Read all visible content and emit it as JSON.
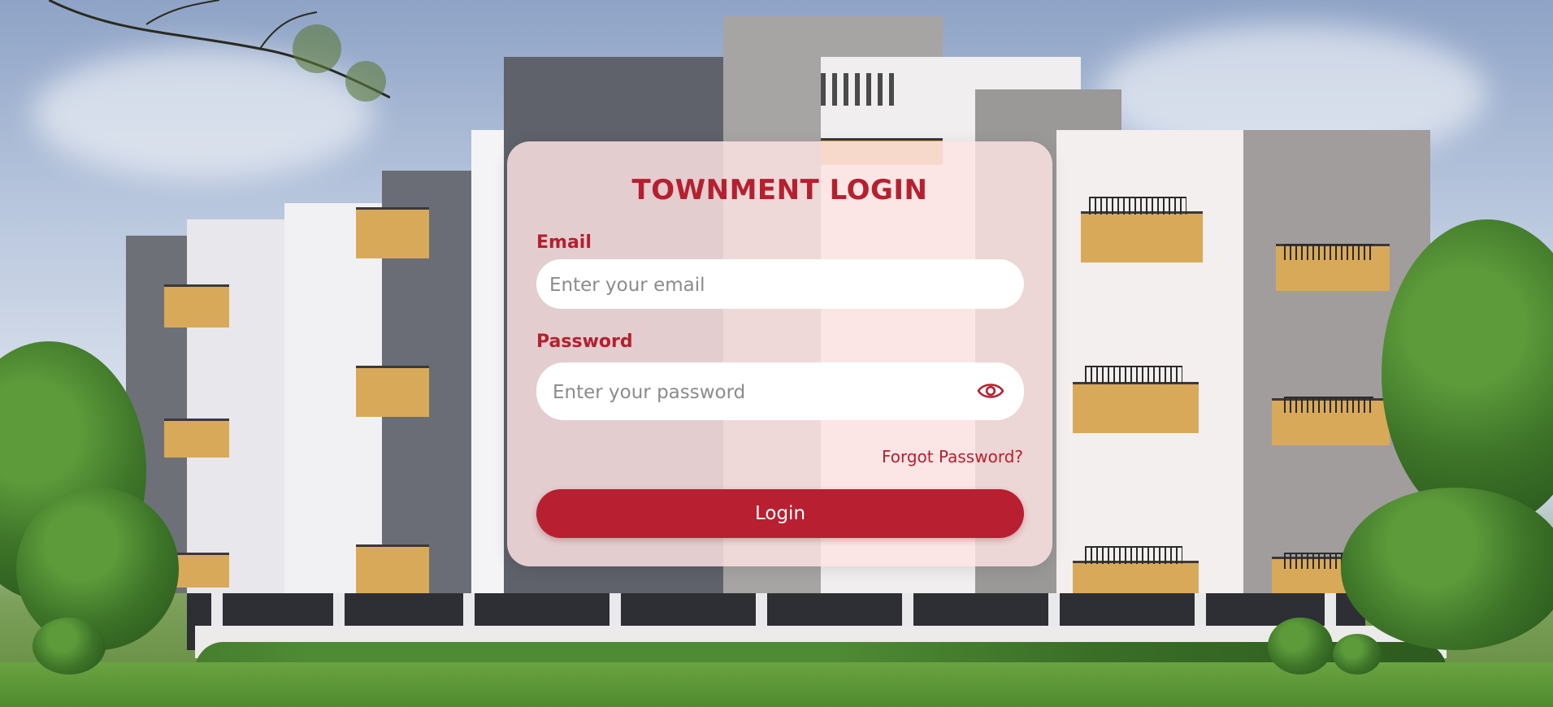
{
  "login": {
    "title": "TOWNMENT LOGIN",
    "email_label": "Email",
    "email_placeholder": "Enter your email",
    "email_value": "",
    "password_label": "Password",
    "password_placeholder": "Enter your password",
    "password_value": "",
    "forgot_link": "Forgot Password?",
    "login_button": "Login"
  },
  "icons": {
    "password_toggle": "eye-icon"
  },
  "colors": {
    "accent": "#b81f30",
    "title": "#b5202e",
    "card_background": "#fde2e2"
  }
}
